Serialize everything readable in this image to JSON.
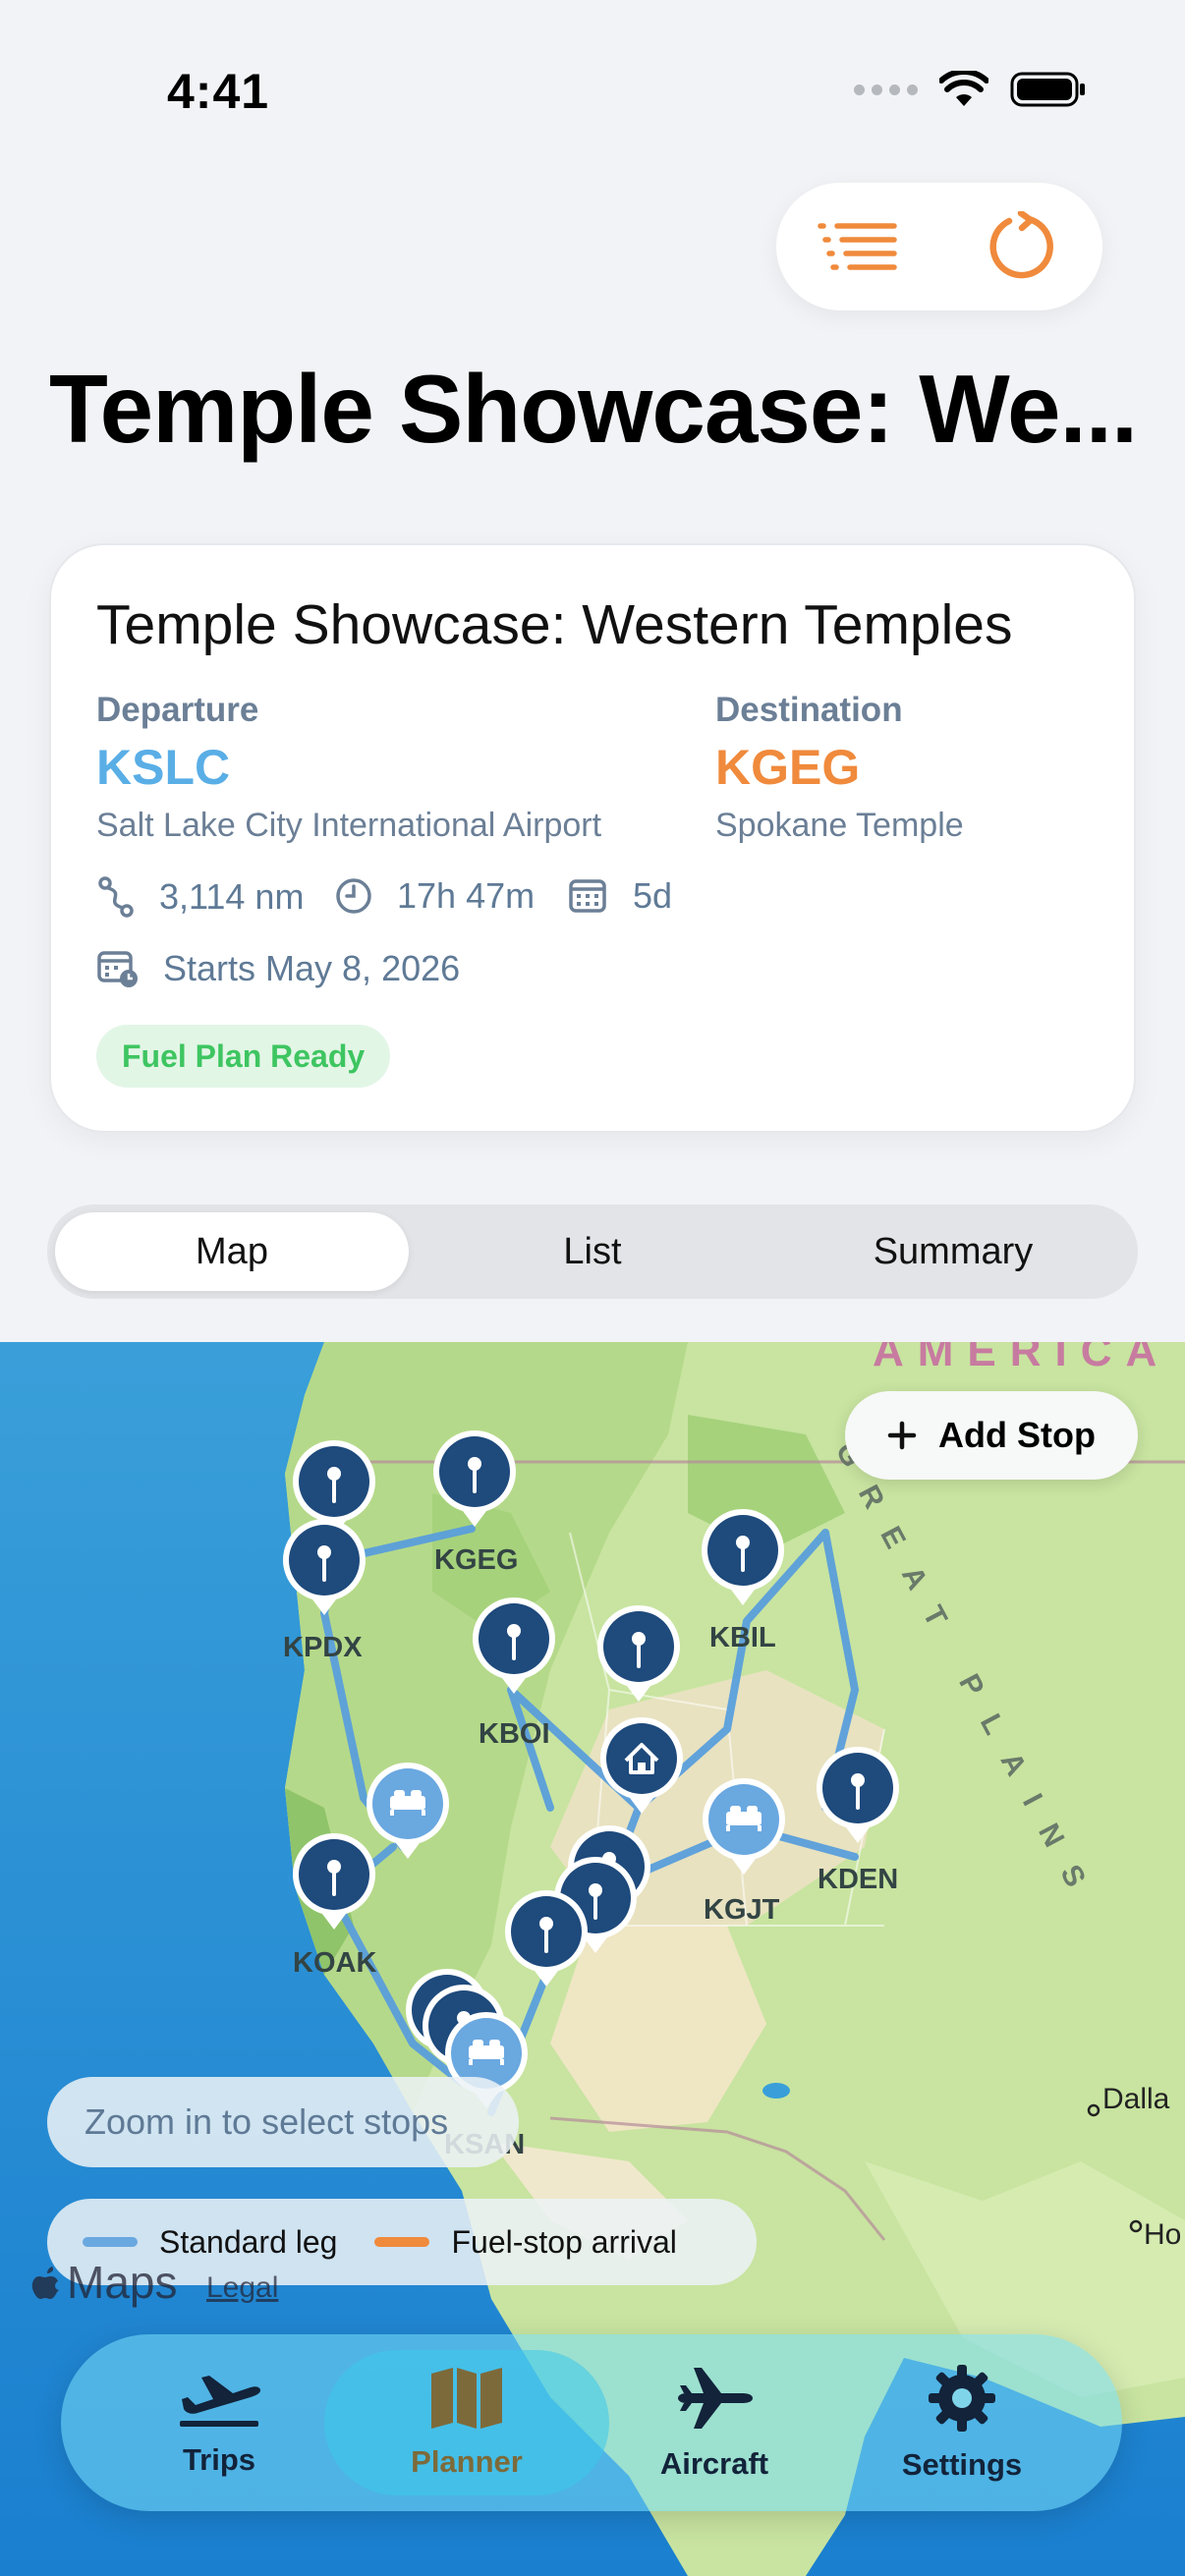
{
  "status_bar": {
    "time": "4:41"
  },
  "header": {
    "title": "Temple Showcase: We..."
  },
  "trip": {
    "title": "Temple Showcase: Western Temples",
    "departure_label": "Departure",
    "departure_code": "KSLC",
    "departure_name": "Salt Lake City International Airport",
    "destination_label": "Destination",
    "destination_code": "KGEG",
    "destination_name": "Spokane Temple",
    "distance": "3,114 nm",
    "duration": "17h 47m",
    "days": "5d",
    "start": "Starts May 8, 2026",
    "badge": "Fuel Plan Ready"
  },
  "segments": [
    "Map",
    "List",
    "Summary"
  ],
  "map": {
    "add_stop": "Add Stop",
    "hint": "Zoom in to select stops",
    "legend": {
      "standard": "Standard leg",
      "fuel": "Fuel-stop arrival"
    },
    "labels": [
      "KGEG",
      "KPDX",
      "KBOI",
      "KBIL",
      "KDEN",
      "KGJT",
      "KOAK",
      "KSAN",
      "Dalla",
      "Ho",
      "AMERICA",
      "GREAT PLAINS"
    ],
    "maps_brand": "Maps",
    "legal": "Legal"
  },
  "tabs": [
    "Trips",
    "Planner",
    "Aircraft",
    "Settings"
  ],
  "colors": {
    "accent": "#f08a3c",
    "departure": "#5aaee6",
    "destination": "#f08a3c",
    "pin": "#1e4a7c",
    "route": "#5a9fdc",
    "badge_text": "#3ec561"
  }
}
